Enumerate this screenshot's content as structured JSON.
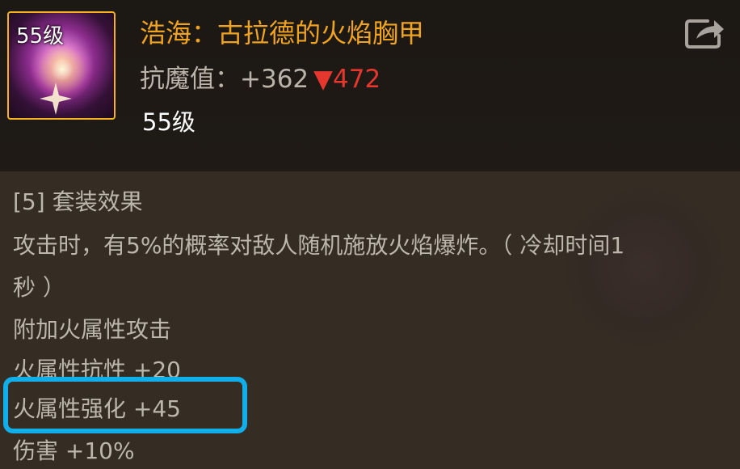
{
  "item": {
    "icon_level": "55级",
    "name": "浩海：古拉德的火焰胸甲",
    "stat_label": "抗魔值：",
    "stat_value": "+362",
    "stat_diff": "▼472",
    "level": "55级",
    "icon": "flame-armor-icon"
  },
  "header": {
    "share_icon": "share-icon"
  },
  "description": {
    "set_title": "[5] 套装效果",
    "line_1": "攻击时，有5%的概率对敌人随机施放火焰爆炸。（ 冷却时间1",
    "line_2": "秒 ）",
    "line_3": "附加火属性攻击",
    "line_4": "火属性抗性 +20",
    "line_5": "火属性强化 +45",
    "line_6": "伤害 +10%"
  },
  "colors": {
    "item_name": "#f0a321",
    "stat_diff": "#e5372e",
    "highlight": "#11aeea",
    "icon_border": "#f5b21d",
    "body_text": "#bdb6ad"
  }
}
